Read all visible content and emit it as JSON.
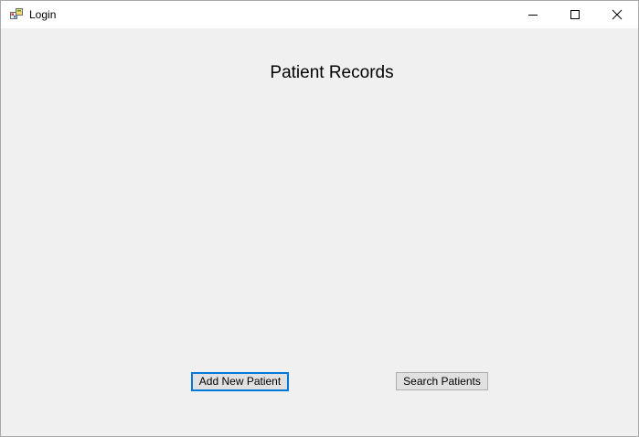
{
  "window": {
    "title": "Login",
    "icon": "winforms-app-icon",
    "controls": {
      "minimize": "minimize-icon",
      "maximize": "maximize-icon",
      "close": "close-icon"
    }
  },
  "form": {
    "heading": "Patient Records",
    "buttons": {
      "add_new_patient": "Add New Patient",
      "search_patients": "Search Patients"
    }
  },
  "colors": {
    "form_background": "#f0f0f0",
    "titlebar_background": "#ffffff",
    "button_background": "#e1e1e1",
    "focus_border": "#0078d7"
  }
}
